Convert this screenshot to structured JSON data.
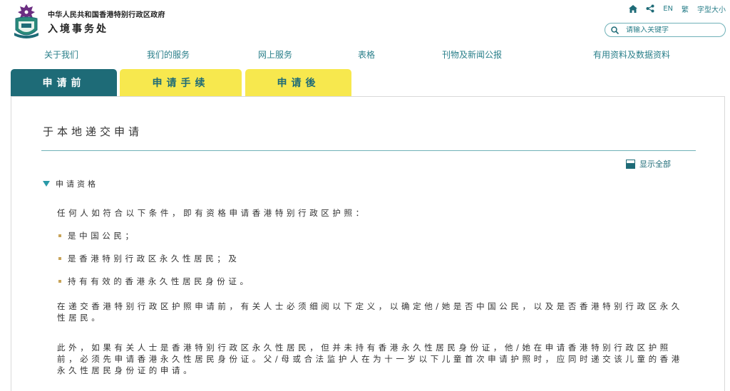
{
  "header": {
    "gov_name": "中华人民共和国香港特别行政区政府",
    "dept_name": "入境事务处"
  },
  "utility": {
    "home_icon": "home-icon",
    "share_icon": "share-icon",
    "lang_en": "EN",
    "lang_tc": "繁",
    "font_size": "字型大小"
  },
  "search": {
    "placeholder": "请输入关键字"
  },
  "nav": {
    "items": [
      {
        "label": "关于我们"
      },
      {
        "label": "我们的服务"
      },
      {
        "label": "网上服务"
      },
      {
        "label": "表格"
      },
      {
        "label": "刊物及新闻公报"
      },
      {
        "label": "有用资料及数据资料"
      }
    ]
  },
  "tabs": [
    {
      "label": "申请前",
      "active": true
    },
    {
      "label": "申请手续",
      "active": false
    },
    {
      "label": "申请後",
      "active": false
    }
  ],
  "content": {
    "title": "于本地递交申请",
    "show_all": "显示全部",
    "section_title": "申请资格",
    "intro": "任何人如符合以下条件，即有资格申请香港特别行政区护照：",
    "bullets": [
      "是中国公民；",
      "是香港特别行政区永久性居民；及",
      "持有有效的香港永久性居民身份证。"
    ],
    "para1": "在递交香港特别行政区护照申请前，有关人士必须细阅以下定义，以确定他/她是否中国公民，以及是否香港特别行政区永久性居民。",
    "para2": "此外，如果有关人士是香港特别行政区永久性居民，但并未持有香港永久性居民身份证，他/她在申请香港特别行政区护照前，必须先申请香港永久性居民身份证。父/母或合法监护人在为十一岁以下儿童首次申请护照时，应同时递交该儿童的香港永久性居民身份证的申请。"
  },
  "colors": {
    "teal_dark": "#1e6b77",
    "teal_link": "#2a7f8a",
    "tab_yellow": "#f7e84e",
    "bullet_gold": "#c8a45a"
  }
}
